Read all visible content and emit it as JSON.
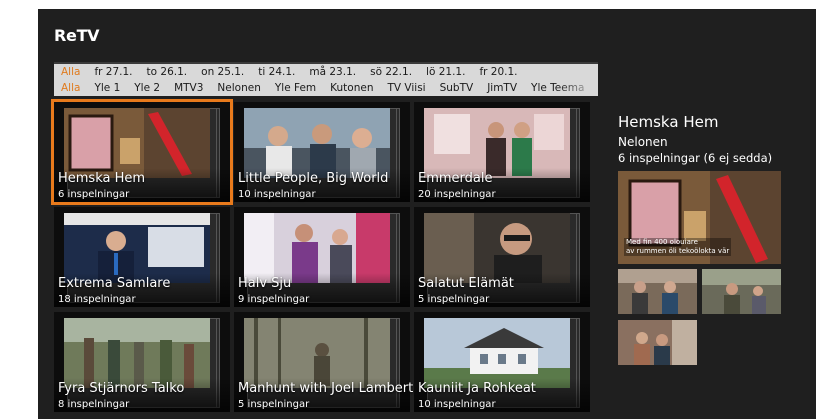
{
  "app": {
    "title": "ReTV"
  },
  "date_filters": [
    "Alla",
    "fr 27.1.",
    "to 26.1.",
    "on 25.1.",
    "ti 24.1.",
    "må 23.1.",
    "sö 22.1.",
    "lö 21.1.",
    "fr 20.1."
  ],
  "channel_filters": [
    "Alla",
    "Yle 1",
    "Yle 2",
    "MTV3",
    "Nelonen",
    "Yle Fem",
    "Kutonen",
    "TV Viisi",
    "SubTV",
    "JimTV",
    "Yle Teema"
  ],
  "shows": [
    {
      "title": "Hemska Hem",
      "count": "6 inspelningar",
      "selected": true
    },
    {
      "title": "Little People, Big World",
      "count": "10 inspelningar"
    },
    {
      "title": "Emmerdale",
      "count": "20 inspelningar"
    },
    {
      "title": "Extrema Samlare",
      "count": "18 inspelningar"
    },
    {
      "title": "Halv Sju",
      "count": "9 inspelningar"
    },
    {
      "title": "Salatut Elämät",
      "count": "5 inspelningar"
    },
    {
      "title": "Fyra Stjärnors Talko",
      "count": "8 inspelningar"
    },
    {
      "title": "Manhunt with Joel Lambert",
      "count": "5 inspelningar"
    },
    {
      "title": "Kauniit Ja Rohkeat",
      "count": "10 inspelningar"
    }
  ],
  "detail": {
    "title": "Hemska Hem",
    "channel": "Nelonen",
    "recordings": "6 inspelningar (6 ej sedda)",
    "caption_line1": "Med fin 400 olouiare",
    "caption_line2": "av rummen öli tekoölokta vär"
  },
  "colors": {
    "accent": "#e87a1c",
    "background": "#1f1f1f",
    "filter_bar": "#d9d9d9"
  }
}
